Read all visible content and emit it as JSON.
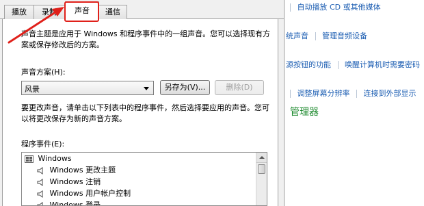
{
  "background_panel": {
    "line1": [
      "自动播放 CD 或其他媒体"
    ],
    "line2": [
      "统声音",
      "管理音频设备"
    ],
    "line3": [
      "源按钮的功能",
      "唤醒计算机时需要密码"
    ],
    "line4": [
      "调整屏幕分辨率",
      "连接到外部显示"
    ],
    "heading": "管理器"
  },
  "tabs": [
    {
      "label": "播放"
    },
    {
      "label": "录制"
    },
    {
      "label": "声音"
    },
    {
      "label": "通信"
    }
  ],
  "intro_text_1": "声音主题是应用于 Windows 和程序事件中的一组声音。您可以选择现有方",
  "intro_text_2": "案或保存修改后的方案。",
  "scheme_label": "声音方案(H):",
  "scheme_value": "风景",
  "save_as_label": "另存为(V)...",
  "delete_label": "删除(D)",
  "change_text_1": "要更改声音，请单击以下列表中的程序事件，然后选择要应用的声音。您可",
  "change_text_2": "以将更改保存为新的声音方案。",
  "events_label": "程序事件(E):",
  "events": [
    "Windows",
    "Windows 更改主题",
    "Windows 注销",
    "Windows 用户帐户控制",
    "Windows 登录"
  ],
  "colors": {
    "accent_red": "#e0201a",
    "link_blue": "#1e5fb3",
    "heading_green": "#1d8a2e"
  }
}
